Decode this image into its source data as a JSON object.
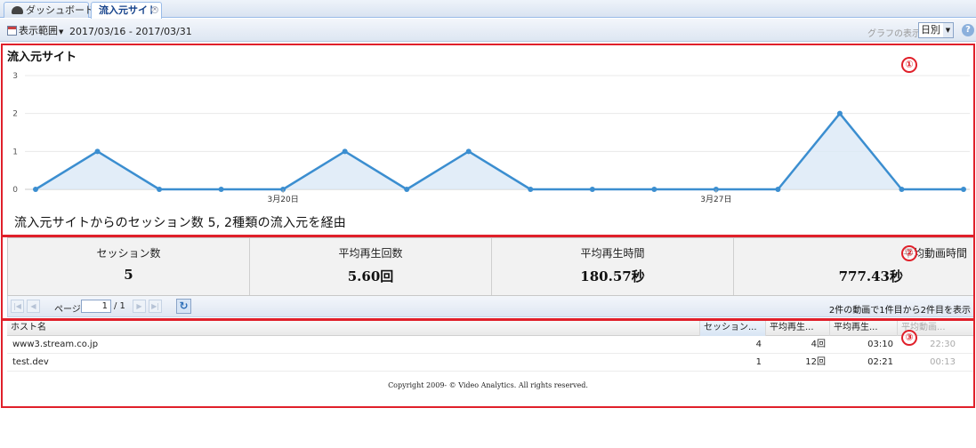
{
  "tabs": [
    {
      "label": "ダッシュボード",
      "active": false
    },
    {
      "label": "流入元サイト",
      "active": true
    }
  ],
  "toolbar": {
    "range_label": "表示範囲",
    "date_range": "2017/03/16 - 2017/03/31",
    "graph_label": "グラフの表示",
    "period_value": "日別",
    "help_icon": "question-icon"
  },
  "chart_panel": {
    "title": "流入元サイト",
    "summary": "流入元サイトからのセッション数 5, 2種類の流入元を経由"
  },
  "chart_data": {
    "type": "area",
    "title": "",
    "xlabel": "",
    "ylabel": "",
    "x": [
      "2017/03/16",
      "2017/03/17",
      "2017/03/18",
      "2017/03/19",
      "2017/03/20",
      "2017/03/21",
      "2017/03/22",
      "2017/03/23",
      "2017/03/24",
      "2017/03/25",
      "2017/03/26",
      "2017/03/27",
      "2017/03/28",
      "2017/03/29",
      "2017/03/30",
      "2017/03/31"
    ],
    "values": [
      0,
      1,
      0,
      0,
      0,
      1,
      0,
      1,
      0,
      0,
      0,
      0,
      0,
      2,
      0,
      0
    ],
    "x_tick_labels": [
      {
        "index": 4,
        "label": "3月20日"
      },
      {
        "index": 11,
        "label": "3月27日"
      }
    ],
    "y_ticks": [
      "0",
      "1",
      "2",
      "3"
    ],
    "ylim": [
      0,
      3
    ],
    "grid": true,
    "line_color": "#3b8ed0",
    "fill_color": "#dbe9f6"
  },
  "stats": [
    {
      "label": "セッション数",
      "value": "5"
    },
    {
      "label": "平均再生回数",
      "value": "5.60回"
    },
    {
      "label": "平均再生時間",
      "value": "180.57秒"
    },
    {
      "label": "平均動画時間",
      "value": "777.43秒"
    }
  ],
  "pager": {
    "page_label": "ページ",
    "page_value": "1",
    "page_of": "/ 1",
    "info": "2件の動画で1件目から2件目を表示"
  },
  "grid": {
    "columns": [
      "ホスト名",
      "セッション...",
      "平均再生...",
      "平均再生...",
      "平均動画..."
    ],
    "rows": [
      [
        "www3.stream.co.jp",
        "4",
        "4回",
        "03:10",
        "22:30"
      ],
      [
        "test.dev",
        "1",
        "12回",
        "02:21",
        "00:13"
      ]
    ]
  },
  "footer": {
    "copyright": "Copyright 2009- © Video Analytics. All rights reserved."
  },
  "annotations": [
    "①",
    "②",
    "③"
  ],
  "colors": {
    "annotation": "#e0202a",
    "accent": "#15428b"
  }
}
